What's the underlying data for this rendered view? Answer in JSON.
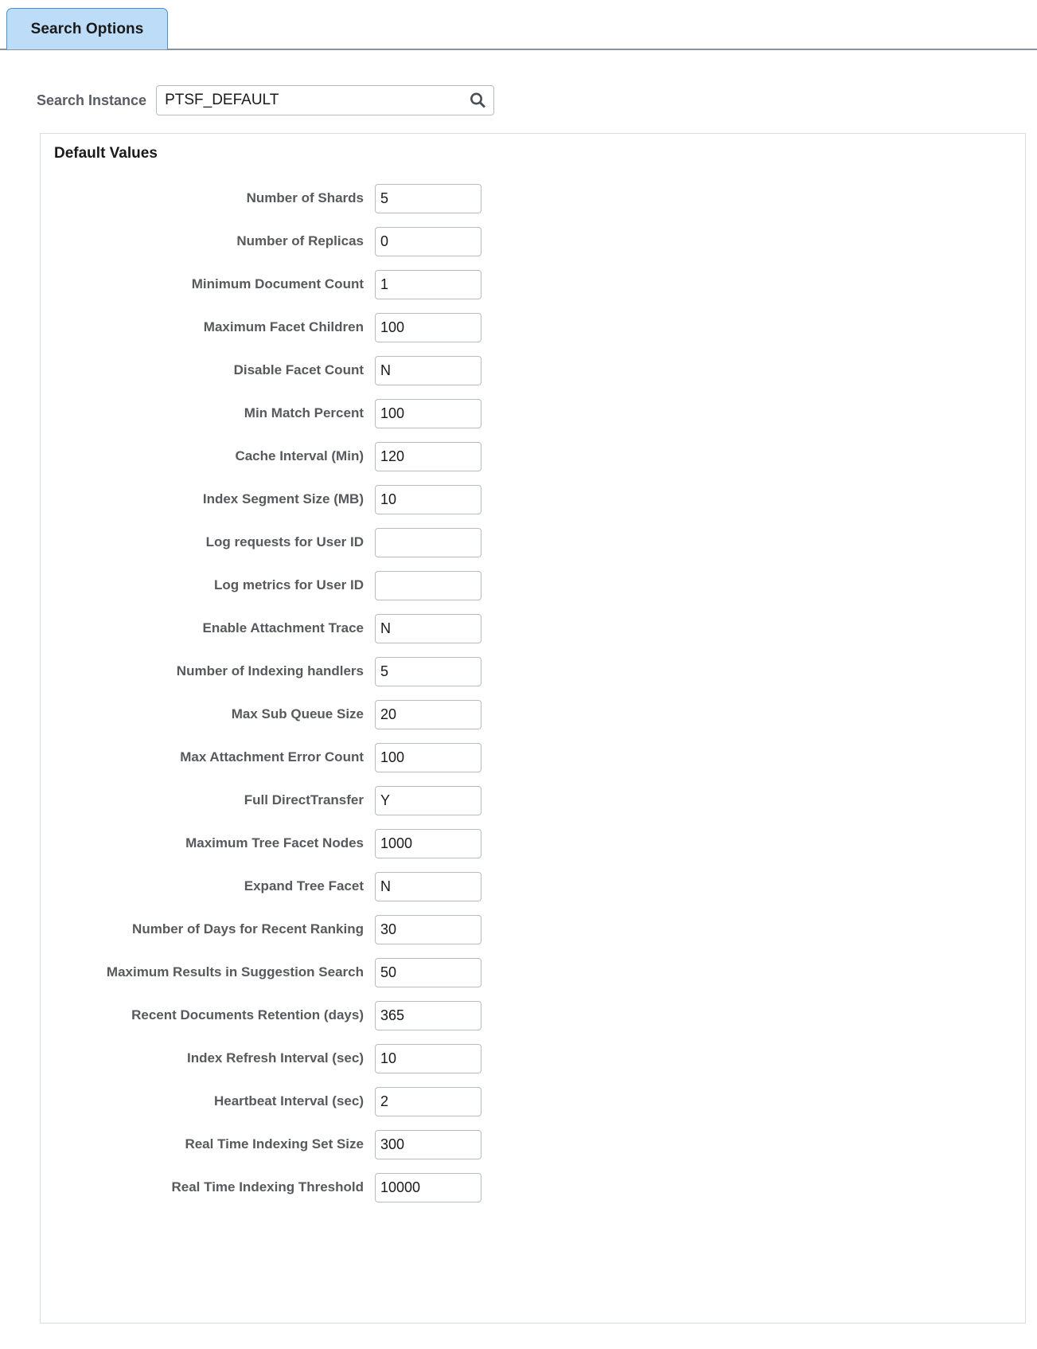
{
  "tabs": [
    {
      "label": "Search Options",
      "active": true
    }
  ],
  "search": {
    "label": "Search Instance",
    "value": "PTSF_DEFAULT",
    "placeholder": "",
    "icon": "search-icon"
  },
  "panel": {
    "title": "Default Values",
    "fields": [
      {
        "label": "Number of Shards",
        "value": "5"
      },
      {
        "label": "Number of Replicas",
        "value": "0"
      },
      {
        "label": "Minimum Document Count",
        "value": "1"
      },
      {
        "label": "Maximum Facet Children",
        "value": "100"
      },
      {
        "label": "Disable Facet Count",
        "value": "N"
      },
      {
        "label": "Min Match Percent",
        "value": "100"
      },
      {
        "label": "Cache Interval (Min)",
        "value": "120"
      },
      {
        "label": "Index Segment Size (MB)",
        "value": "10"
      },
      {
        "label": "Log requests for User ID",
        "value": ""
      },
      {
        "label": "Log metrics for User ID",
        "value": ""
      },
      {
        "label": "Enable Attachment Trace",
        "value": "N"
      },
      {
        "label": "Number of Indexing handlers",
        "value": "5"
      },
      {
        "label": "Max Sub Queue Size",
        "value": "20"
      },
      {
        "label": "Max Attachment Error Count",
        "value": "100"
      },
      {
        "label": "Full DirectTransfer",
        "value": "Y"
      },
      {
        "label": "Maximum Tree Facet Nodes",
        "value": "1000"
      },
      {
        "label": "Expand Tree Facet",
        "value": "N"
      },
      {
        "label": "Number of Days for Recent Ranking",
        "value": "30"
      },
      {
        "label": "Maximum Results in Suggestion Search",
        "value": "50"
      },
      {
        "label": "Recent Documents Retention (days)",
        "value": "365"
      },
      {
        "label": "Index Refresh Interval (sec)",
        "value": "10"
      },
      {
        "label": "Heartbeat Interval (sec)",
        "value": "2"
      },
      {
        "label": "Real Time Indexing Set Size",
        "value": "300"
      },
      {
        "label": "Real Time Indexing Threshold",
        "value": "10000"
      }
    ]
  },
  "colors": {
    "tab_active_bg": "#bcdcf8",
    "tab_active_border": "#4a8fd0",
    "tabstrip_rule": "#8a929b",
    "label_text": "#57595c",
    "input_border": "#b6bcc2",
    "panel_border": "#d7dde3",
    "icon": "#4a4f55"
  }
}
